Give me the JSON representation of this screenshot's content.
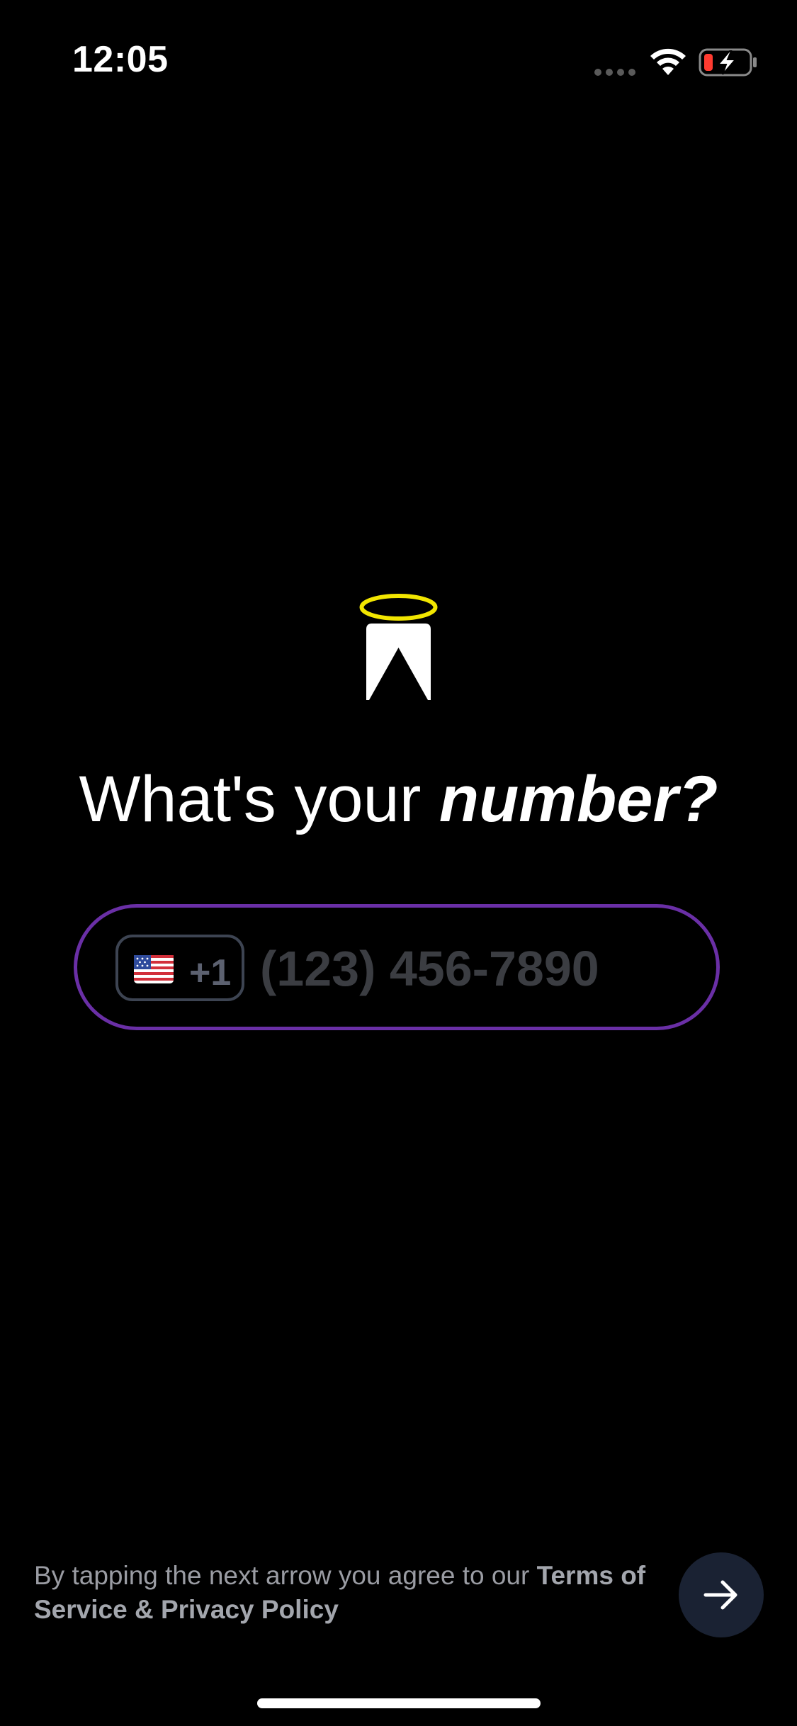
{
  "status_bar": {
    "time": "12:05",
    "signal_icon": "cellular-signal-dots-icon",
    "wifi_icon": "wifi-icon",
    "battery_icon": "battery-charging-icon",
    "battery_level_fraction": 0.15
  },
  "logo": {
    "icon": "halo-logo-icon",
    "halo_color": "#f2e600"
  },
  "heading": {
    "regular": "What's your ",
    "emphasis": "number?"
  },
  "phone_field": {
    "country_flag_icon": "us-flag-icon",
    "dial_code": "+1",
    "value": "",
    "placeholder": "(123) 456-7890",
    "border_color": "#6a2fa6"
  },
  "footer": {
    "terms_prefix": "By tapping the next arrow you agree to our ",
    "terms_link": "Terms of Service & Privacy Policy",
    "next_icon": "arrow-right-icon"
  },
  "colors": {
    "background": "#000000",
    "accent": "#6a2fa6",
    "next_button_bg": "#1a2233"
  }
}
